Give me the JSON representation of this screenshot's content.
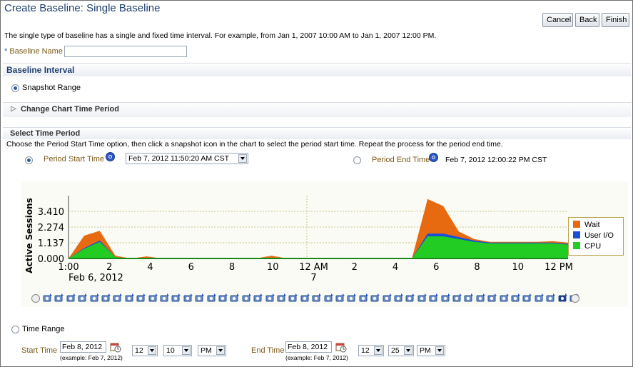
{
  "page": {
    "title": "Create Baseline: Single Baseline",
    "intro": "The single type of baseline has a single and fixed time interval. For example, from Jan 1, 2007 10:00 AM to Jan 1, 2007 12:00 PM."
  },
  "buttons": {
    "cancel": "Cancel",
    "back": "Back",
    "finish": "Finish"
  },
  "baseline_name": {
    "required_mark": "*",
    "label": "Baseline Name",
    "value": ""
  },
  "baseline_interval": {
    "heading": "Baseline Interval",
    "snapshot_range_label": "Snapshot Range",
    "snapshot_range_selected": true,
    "change_chart_label": "Change Chart Time Period"
  },
  "select_time_period": {
    "heading": "Select Time Period",
    "instructions": "Choose the Period Start Time option, then click a snapshot icon in the chart to select the period start time. Repeat the process for the period end time.",
    "start_label": "Period Start Time",
    "start_value": "Feb 7, 2012 11:50:20 AM CST",
    "end_label": "Period End Time",
    "end_value": "Feb 7, 2012 12:00:22 PM CST"
  },
  "chart_data": {
    "type": "area",
    "ylabel": "Active Sessions",
    "yticks": [
      "3.410",
      "2.274",
      "1.137",
      "0.000"
    ],
    "ylim": [
      0,
      4.3
    ],
    "xticks": [
      "1:00",
      "2",
      "4",
      "6",
      "8",
      "10",
      "12 AM",
      "2",
      "4",
      "6",
      "8",
      "10",
      "12 PM"
    ],
    "xticks_sub": {
      "0": "Feb 6, 2012",
      "6": "7"
    },
    "colors": {
      "Wait": "#e86a10",
      "User I/O": "#1a4fd6",
      "CPU": "#22cc22"
    },
    "series": [
      {
        "name": "CPU",
        "values": [
          0,
          0.7,
          1.2,
          0.1,
          0,
          0,
          0,
          0,
          0,
          0,
          0,
          0,
          0,
          0,
          0,
          0,
          0,
          0,
          0,
          0,
          0,
          0,
          0,
          1.6,
          1.6,
          1.4,
          1.2,
          1.1,
          1.1,
          1.1,
          1.1,
          1.1,
          1.0
        ]
      },
      {
        "name": "User I/O",
        "values": [
          0,
          0.05,
          0.1,
          0,
          0,
          0,
          0,
          0,
          0,
          0,
          0,
          0,
          0,
          0,
          0,
          0,
          0,
          0,
          0,
          0,
          0,
          0,
          0,
          0.2,
          0.2,
          0.15,
          0.1,
          0.05,
          0.05,
          0.05,
          0.05,
          0.05,
          0.05
        ]
      },
      {
        "name": "Wait",
        "values": [
          0,
          0.9,
          0.7,
          0.1,
          0,
          0.15,
          0,
          0,
          0,
          0,
          0,
          0,
          0,
          0.2,
          0,
          0,
          0,
          0,
          0,
          0,
          0,
          0,
          0,
          2.5,
          2.0,
          0.4,
          0.1,
          0.05,
          0.05,
          0.05,
          0.05,
          0.1,
          0.1
        ]
      }
    ]
  },
  "legend": [
    {
      "name": "Wait",
      "color": "#e86a10"
    },
    {
      "name": "User I/O",
      "color": "#1a4fd6"
    },
    {
      "name": "CPU",
      "color": "#22cc22"
    }
  ],
  "time_range": {
    "label": "Time Range",
    "start_label": "Start Time",
    "start_date": "Feb 8, 2012",
    "start_hour": "12",
    "start_min": "10",
    "start_ampm": "PM",
    "end_label": "End Time",
    "end_date": "Feb 8, 2012",
    "end_hour": "12",
    "end_min": "25",
    "end_ampm": "PM",
    "example": "(example: Feb 7, 2012)"
  }
}
